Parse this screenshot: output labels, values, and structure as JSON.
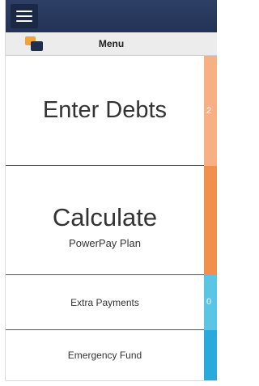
{
  "header": {
    "menu_label": "Menu"
  },
  "cards": [
    {
      "title": "Enter Debts",
      "stripe_value": "2",
      "stripe_color": "#f6b083"
    },
    {
      "title": "Calculate",
      "subtitle": "PowerPay Plan",
      "stripe_value": "",
      "stripe_color": "#f0904c"
    },
    {
      "title": "Extra Payments",
      "stripe_value": "0",
      "stripe_color": "#5bc5e6"
    },
    {
      "title": "Emergency Fund",
      "stripe_value": "",
      "stripe_color": "#29a9dc"
    }
  ],
  "colors": {
    "titlebar": "#2e3f66",
    "menu_button": "#1c2946",
    "logo_orange": "#f5a13a",
    "logo_navy": "#1f2d4e"
  },
  "icons": {
    "menu": "hamburger-icon",
    "logo": "app-logo-icon"
  }
}
